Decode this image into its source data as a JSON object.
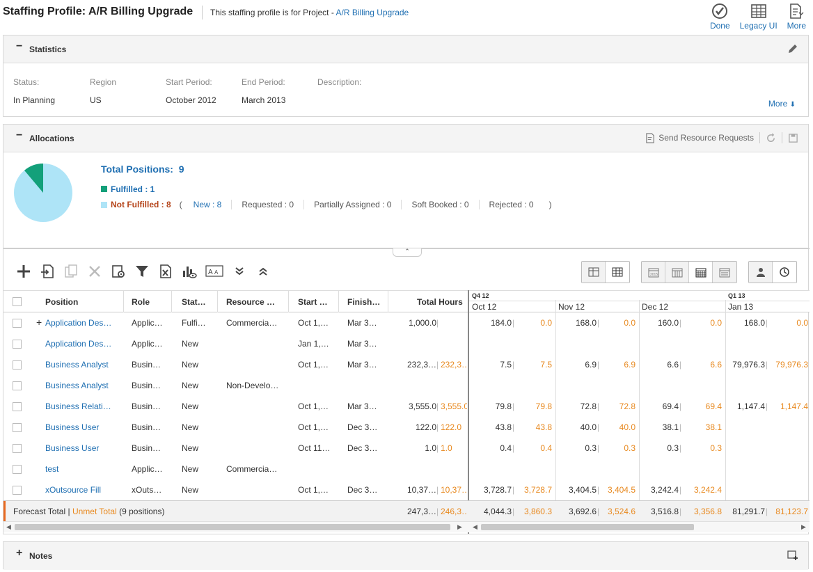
{
  "header": {
    "title": "Staffing Profile: A/R Billing Upgrade",
    "subtitle_prefix": "This staffing profile is for Project - ",
    "project_link": "A/R Billing Upgrade",
    "actions": [
      {
        "label": "Done",
        "icon": "check-circle-icon"
      },
      {
        "label": "Legacy UI",
        "icon": "grid-table-icon"
      },
      {
        "label": "More",
        "icon": "document-menu-icon"
      }
    ]
  },
  "statistics": {
    "toggle": "−",
    "title": "Statistics",
    "edit_icon": "pencil-icon",
    "labels": {
      "status": "Status:",
      "region": "Region",
      "start": "Start Period:",
      "end": "End Period:",
      "description": "Description:"
    },
    "values": {
      "status": "In Planning",
      "region": "US",
      "start": "October 2012",
      "end": "March 2013",
      "description": ""
    },
    "more": "More"
  },
  "allocations": {
    "toggle": "−",
    "title": "Allocations",
    "send_requests": "Send Resource Requests",
    "total_label": "Total Positions:",
    "total_value": "9",
    "fulfilled": "Fulfilled : 1",
    "not_fulfilled": "Not Fulfilled : 8",
    "open_paren": "(",
    "close_paren": ")",
    "status_breakdown": {
      "new": "New : 8",
      "requested": "Requested : 0",
      "partial": "Partially Assigned : 0",
      "soft": "Soft Booked : 0",
      "rejected": "Rejected : 0"
    },
    "pie": {
      "fulfilled": 1,
      "not_fulfilled": 8,
      "fulfilled_color": "#13a07a",
      "not_fulfilled_color": "#aee4f7"
    }
  },
  "grid": {
    "headers": {
      "position": "Position",
      "role": "Role",
      "status": "Stat…",
      "resource": "Resource …",
      "start": "Start …",
      "finish": "Finish…",
      "total_hours": "Total Hours",
      "q4": "Q4 12",
      "q1": "Q1 13",
      "m1": "Oct 12",
      "m2": "Nov 12",
      "m3": "Dec 12",
      "m4": "Jan 13"
    },
    "rows": [
      {
        "expand": "+",
        "position": "Application Des…",
        "role": "Applic…",
        "status": "Fulfi…",
        "resource": "Commercia…",
        "start": "Oct 1,…",
        "finish": "Mar 3…",
        "total": "1,000.0",
        "unmet": "",
        "m": [
          "184.0",
          "0.0",
          "168.0",
          "0.0",
          "160.0",
          "0.0",
          "168.0",
          "0.0"
        ]
      },
      {
        "expand": "",
        "position": "Application Des…",
        "role": "Applic…",
        "status": "New",
        "resource": "",
        "start": "Jan 1,…",
        "finish": "Mar 3…",
        "total": "",
        "unmet": "",
        "m": [
          "",
          "",
          "",
          "",
          "",
          "",
          "",
          ""
        ]
      },
      {
        "expand": "",
        "position": "Business Analyst",
        "role": "Busin…",
        "status": "New",
        "resource": "",
        "start": "Oct 1,…",
        "finish": "Mar 3…",
        "total": "232,3…",
        "unmet": "232,3…",
        "m": [
          "7.5",
          "7.5",
          "6.9",
          "6.9",
          "6.6",
          "6.6",
          "79,976.3",
          "79,976.3"
        ]
      },
      {
        "expand": "",
        "position": "Business Analyst",
        "role": "Busin…",
        "status": "New",
        "resource": "Non-Develo…",
        "start": "",
        "finish": "",
        "total": "",
        "unmet": "",
        "m": [
          "",
          "",
          "",
          "",
          "",
          "",
          "",
          ""
        ]
      },
      {
        "expand": "",
        "position": "Business Relati…",
        "role": "Busin…",
        "status": "New",
        "resource": "",
        "start": "Oct 1,…",
        "finish": "Mar 3…",
        "total": "3,555.0",
        "unmet": "3,555.0",
        "m": [
          "79.8",
          "79.8",
          "72.8",
          "72.8",
          "69.4",
          "69.4",
          "1,147.4",
          "1,147.4"
        ]
      },
      {
        "expand": "",
        "position": "Business User",
        "role": "Busin…",
        "status": "New",
        "resource": "",
        "start": "Oct 1,…",
        "finish": "Dec 3…",
        "total": "122.0",
        "unmet": "122.0",
        "m": [
          "43.8",
          "43.8",
          "40.0",
          "40.0",
          "38.1",
          "38.1",
          "",
          ""
        ]
      },
      {
        "expand": "",
        "position": "Business User",
        "role": "Busin…",
        "status": "New",
        "resource": "",
        "start": "Oct 11…",
        "finish": "Dec 3…",
        "total": "1.0",
        "unmet": "1.0",
        "m": [
          "0.4",
          "0.4",
          "0.3",
          "0.3",
          "0.3",
          "0.3",
          "",
          ""
        ]
      },
      {
        "expand": "",
        "position": "test",
        "role": "Applic…",
        "status": "New",
        "resource": "Commercia…",
        "start": "",
        "finish": "",
        "total": "",
        "unmet": "",
        "m": [
          "",
          "",
          "",
          "",
          "",
          "",
          "",
          ""
        ]
      },
      {
        "expand": "",
        "position": "xOutsource Fill",
        "role": "xOuts…",
        "status": "New",
        "resource": "",
        "start": "Oct 1,…",
        "finish": "Dec 3…",
        "total": "10,37…",
        "unmet": "10,37…",
        "m": [
          "3,728.7",
          "3,728.7",
          "3,404.5",
          "3,404.5",
          "3,242.4",
          "3,242.4",
          "",
          ""
        ]
      }
    ],
    "footer": {
      "forecast_label": "Forecast Total |",
      "unmet_label": "Unmet Total",
      "positions": "(9 positions)",
      "total": "247,3…",
      "unmet": "246,3…",
      "m": [
        "4,044.3",
        "3,860.3",
        "3,692.6",
        "3,524.6",
        "3,516.8",
        "3,356.8",
        "81,291.7",
        "81,123.7"
      ]
    }
  },
  "notes": {
    "toggle": "+",
    "title": "Notes"
  },
  "colors": {
    "link": "#1f6fb2",
    "unmet": "#e8891f",
    "not_fulfilled_label": "#b5451b",
    "footer_accent": "#e8691f"
  }
}
